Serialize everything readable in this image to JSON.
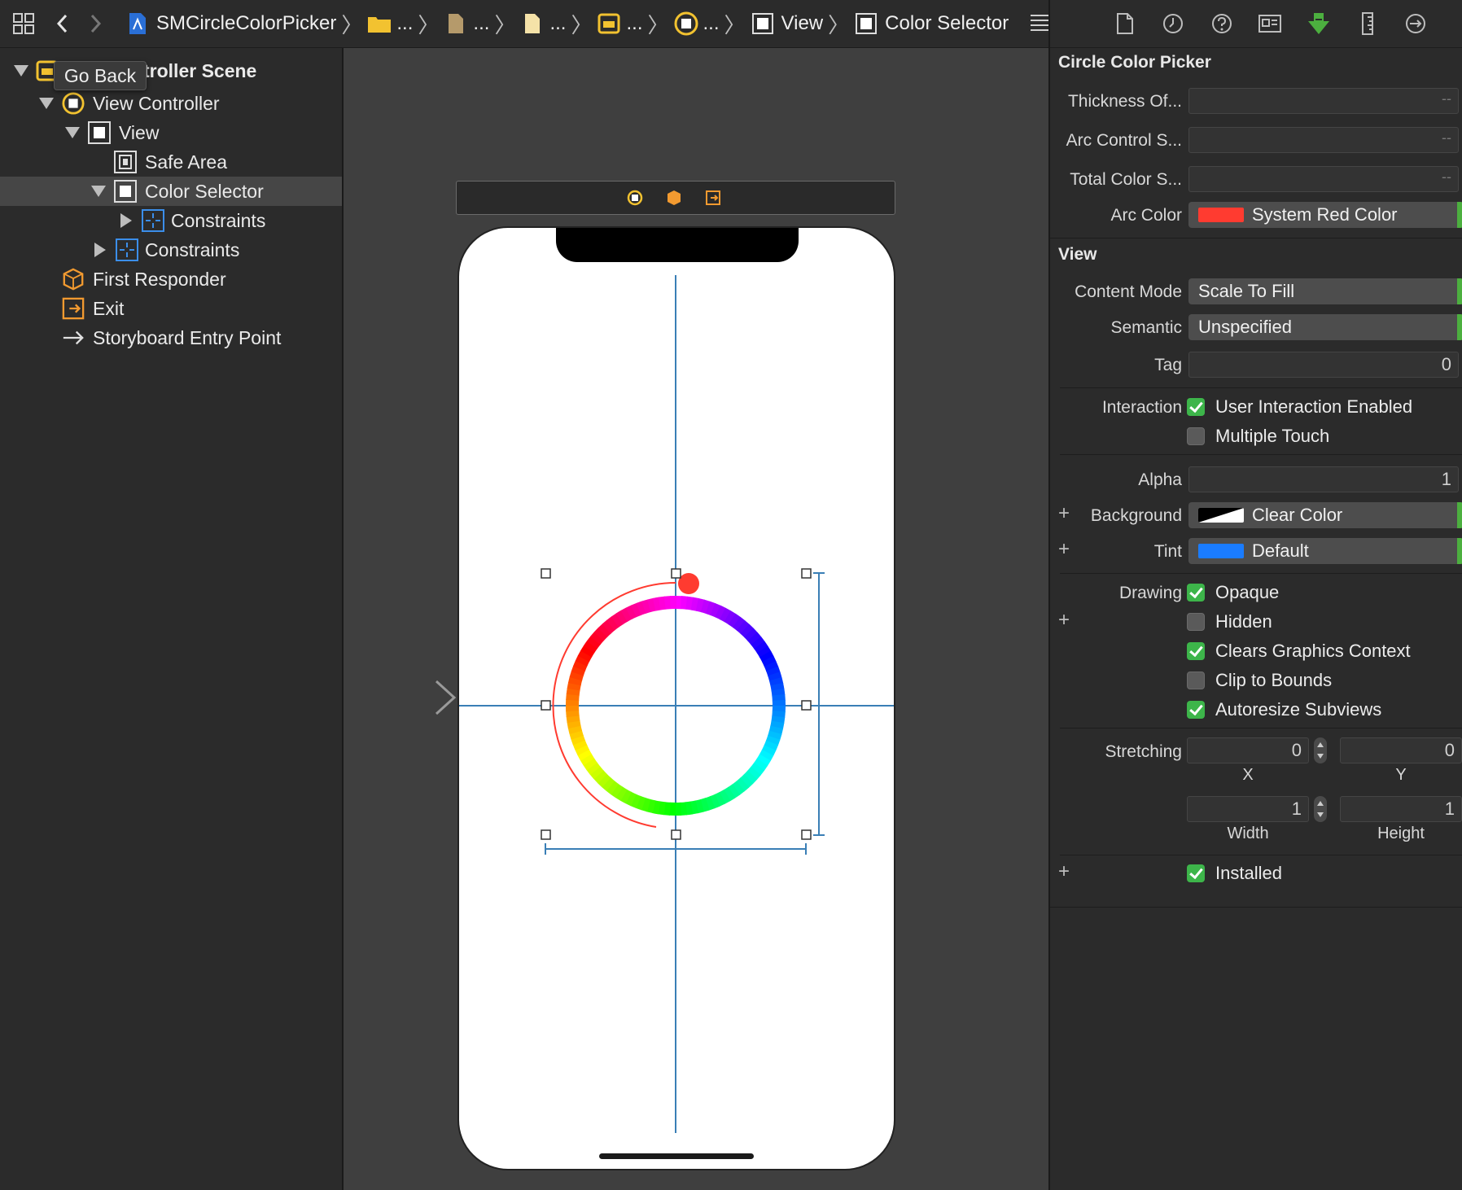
{
  "jumpbar": {
    "project": "SMCircleColorPicker",
    "ellipsis": "...",
    "view": "View",
    "selected": "Color Selector"
  },
  "tooltip": "Go Back",
  "outline": {
    "scene": "View Controller Scene",
    "scene_visible": "troller Scene",
    "view_controller": "View Controller",
    "view": "View",
    "safe_area": "Safe Area",
    "color_selector": "Color Selector",
    "constraints_inner": "Constraints",
    "constraints_outer": "Constraints",
    "first_responder": "First Responder",
    "exit": "Exit",
    "entry_point": "Storyboard Entry Point"
  },
  "inspector": {
    "custom_section": "Circle Color Picker",
    "thickness_label": "Thickness Of...",
    "thickness_value": "--",
    "arc_control_label": "Arc Control S...",
    "arc_control_value": "--",
    "total_color_label": "Total Color S...",
    "total_color_value": "--",
    "arc_color_label": "Arc Color",
    "arc_color_value": "System Red Color",
    "arc_color_swatch": "#ff3b30",
    "view_section": "View",
    "content_mode_label": "Content Mode",
    "content_mode_value": "Scale To Fill",
    "semantic_label": "Semantic",
    "semantic_value": "Unspecified",
    "tag_label": "Tag",
    "tag_value": "0",
    "interaction_label": "Interaction",
    "user_interaction": "User Interaction Enabled",
    "multiple_touch": "Multiple Touch",
    "alpha_label": "Alpha",
    "alpha_value": "1",
    "background_label": "Background",
    "background_value": "Clear Color",
    "tint_label": "Tint",
    "tint_value": "Default",
    "tint_swatch": "#1a7cff",
    "drawing_label": "Drawing",
    "opaque": "Opaque",
    "hidden": "Hidden",
    "clears_graphics": "Clears Graphics Context",
    "clip_to_bounds": "Clip to Bounds",
    "autoresize": "Autoresize Subviews",
    "stretching_label": "Stretching",
    "stretch_x": "0",
    "stretch_y": "0",
    "x_label": "X",
    "y_label": "Y",
    "stretch_width": "1",
    "stretch_height": "1",
    "width_label": "Width",
    "height_label": "Height",
    "installed": "Installed"
  },
  "checkboxes": {
    "user_interaction": true,
    "multiple_touch": false,
    "opaque": true,
    "hidden": false,
    "clears_graphics": true,
    "clip_to_bounds": false,
    "autoresize": true,
    "installed": true
  },
  "colors": {
    "accent_green": "#4caf3f",
    "guide_blue": "#3a7fb6",
    "handle_red": "#ff3b30"
  }
}
